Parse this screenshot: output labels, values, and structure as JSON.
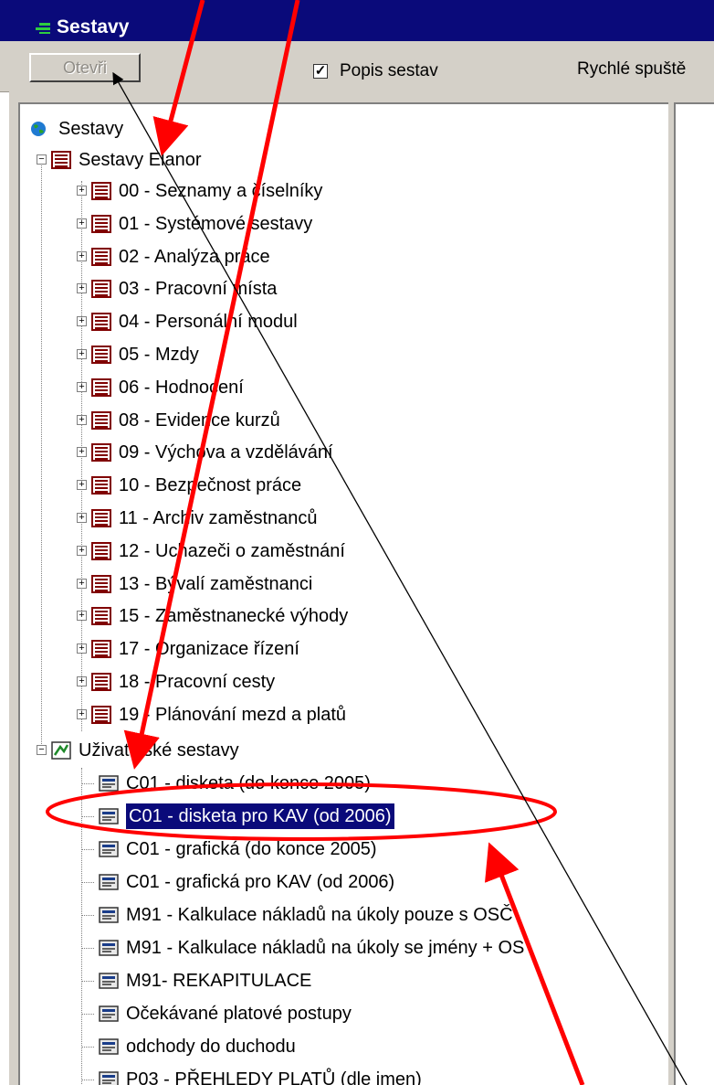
{
  "window": {
    "title": "Sestavy"
  },
  "toolbar": {
    "open_label": "Otevři",
    "describe_label": "Popis sestav",
    "describe_checked": true,
    "quick_label": "Rychlé spuště"
  },
  "tree": {
    "root": "Sestavy",
    "groups": [
      {
        "label": "Sestavy Elanor",
        "children": [
          "00 - Seznamy a číselníky",
          "01 - Systémové sestavy",
          "02 - Analýza práce",
          "03 - Pracovní místa",
          "04 - Personální modul",
          "05 - Mzdy",
          "06 - Hodnocení",
          "08 - Evidence kurzů",
          "09 - Výchova a vzdělávání",
          "10 - Bezpečnost práce",
          "11 - Archiv zaměstnanců",
          "12 - Uchazeči o zaměstnání",
          "13 - Bývalí zaměstnanci",
          "15 - Zaměstnanecké výhody",
          "17 - Organizace řízení",
          "18 - Pracovní cesty",
          "19 - Plánování mezd a platů"
        ]
      },
      {
        "label": "Uživatelské sestavy",
        "children": [
          "C01 - disketa (do konce 2005)",
          "C01 - disketa pro KAV (od 2006)",
          "C01 - grafická (do konce 2005)",
          "C01 - grafická pro KAV (od 2006)",
          "M91 - Kalkulace nákladů na úkoly pouze s OSČ",
          "M91 - Kalkulace nákladů na úkoly se jmény + OS",
          "M91- REKAPITULACE",
          "Očekávané platové postupy",
          "odchody do duchodu",
          "P03 - PŘEHLEDY PLATŮ (dle jmen)"
        ],
        "selected": "C01 - disketa pro KAV (od 2006)"
      }
    ]
  },
  "colors": {
    "titlebar": "#0a0a7a",
    "selection": "#0a0a7a",
    "annotation_red": "#ff0000",
    "face": "#d4d0c8"
  }
}
